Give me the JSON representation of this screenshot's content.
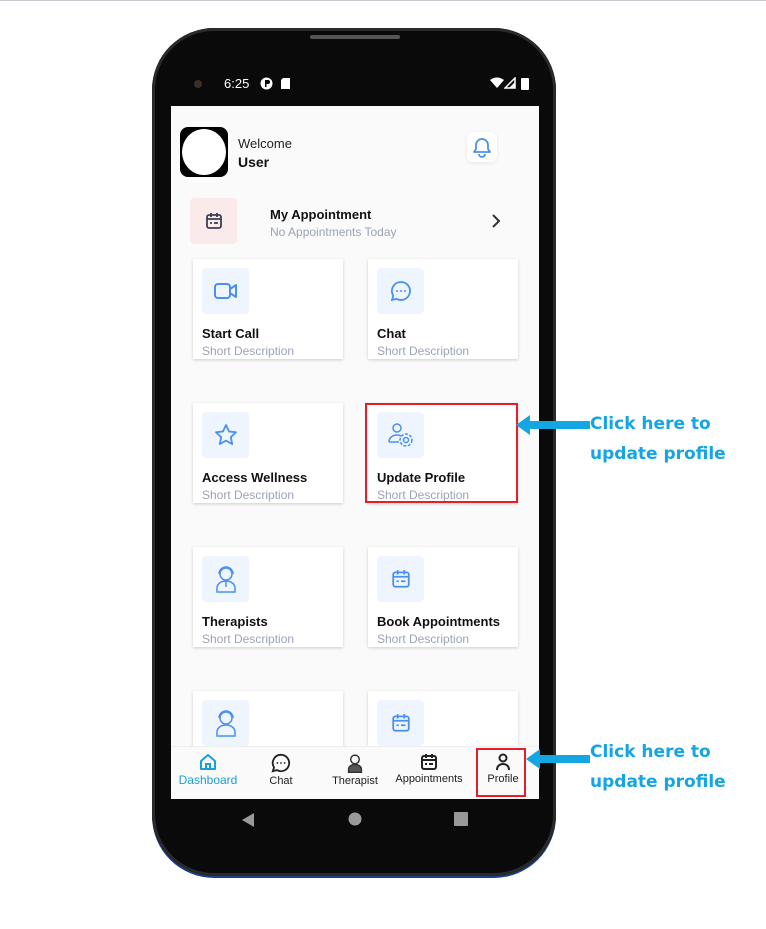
{
  "status_bar": {
    "time": "6:25"
  },
  "header": {
    "welcome": "Welcome",
    "username": "User"
  },
  "appointment": {
    "title": "My Appointment",
    "subtitle": "No Appointments Today"
  },
  "cards": [
    {
      "title": "Start Call",
      "desc": "Short Description",
      "icon": "video-icon"
    },
    {
      "title": "Chat",
      "desc": "Short Description",
      "icon": "chat-bubble-icon"
    },
    {
      "title": "Access Wellness",
      "desc": "Short Description",
      "icon": "star-icon"
    },
    {
      "title": "Update Profile",
      "desc": "Short Description",
      "icon": "user-settings-icon"
    },
    {
      "title": "Therapists",
      "desc": "Short Description",
      "icon": "therapist-icon"
    },
    {
      "title": "Book Appointments",
      "desc": "Short Description",
      "icon": "calendar-icon"
    },
    {
      "title": "",
      "desc": "",
      "icon": "therapist-icon"
    },
    {
      "title": "",
      "desc": "",
      "icon": "calendar-icon"
    }
  ],
  "bottom_nav": [
    {
      "label": "Dashboard",
      "active": true
    },
    {
      "label": "Chat",
      "active": false
    },
    {
      "label": "Therapist",
      "active": false
    },
    {
      "label": "Appointments",
      "active": false
    },
    {
      "label": "Profile",
      "active": false
    }
  ],
  "annotations": [
    {
      "line1": "Click here to",
      "line2": "update profile"
    },
    {
      "line1": "Click here to",
      "line2": "update profile"
    }
  ],
  "colors": {
    "accent": "#1a9fd6",
    "icon_blue": "#4a90f0",
    "highlight": "#e3202a",
    "callout": "#14a5e3"
  }
}
